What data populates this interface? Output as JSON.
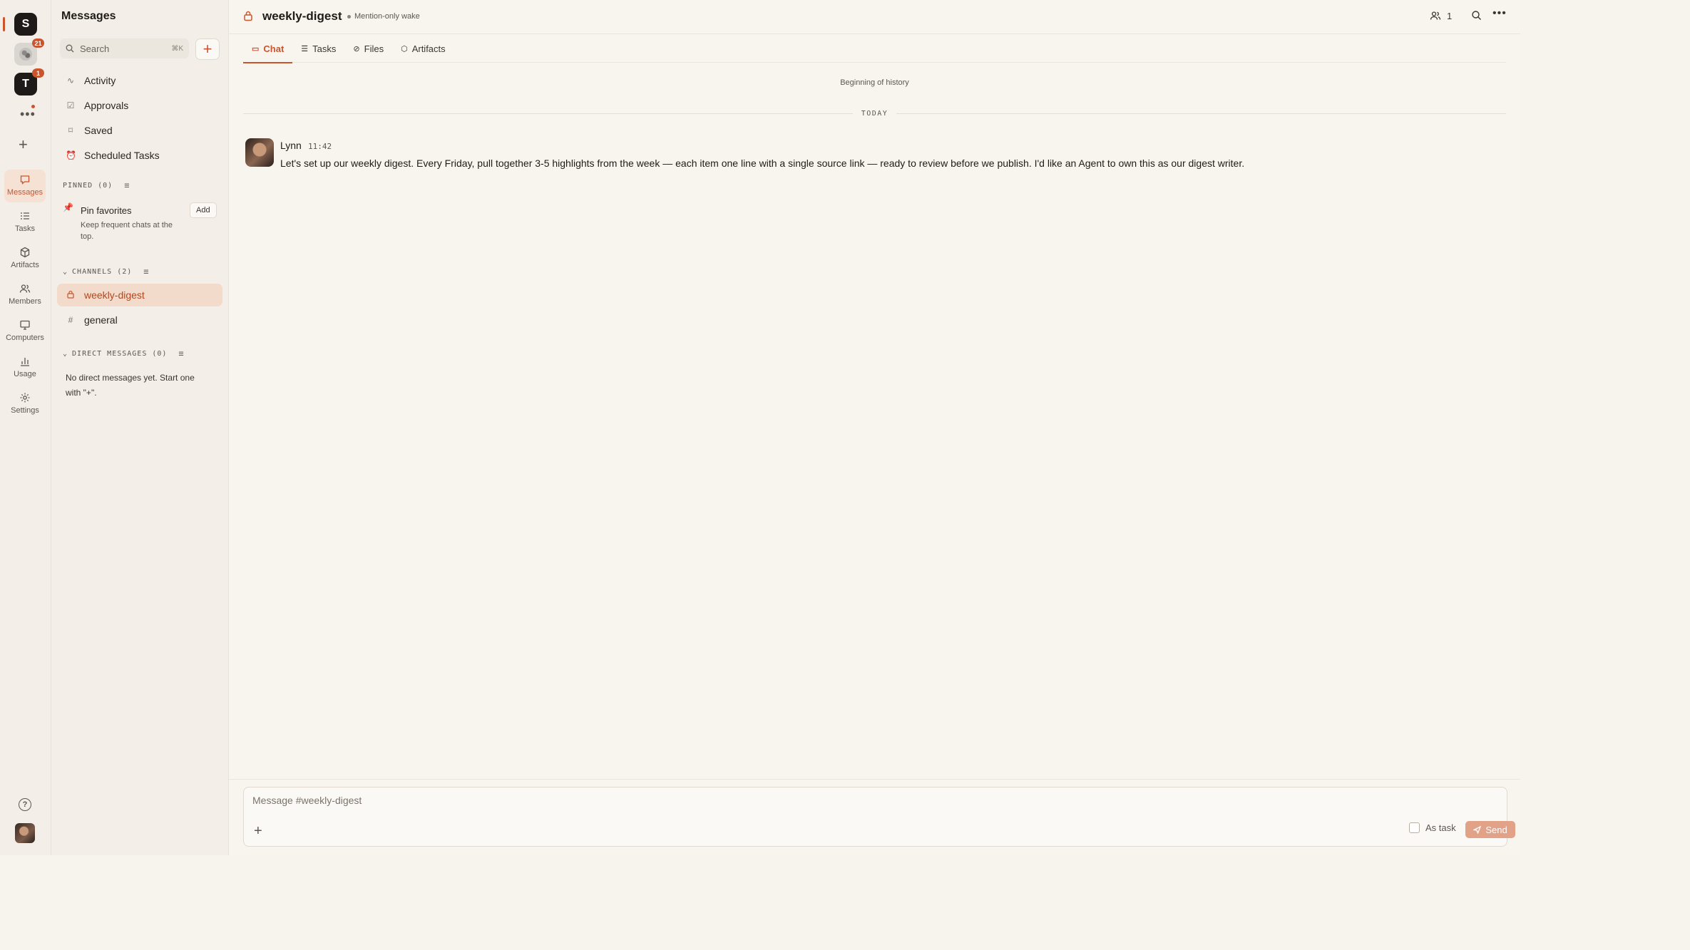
{
  "rail": {
    "workspaces": [
      {
        "letter": "S",
        "badge": ""
      },
      {
        "letter": "",
        "badge": "21"
      },
      {
        "letter": "T",
        "badge": "1"
      }
    ],
    "more": "•••",
    "add": "+",
    "nav": [
      {
        "label": "Messages",
        "icon": "message-icon",
        "active": true
      },
      {
        "label": "Tasks",
        "icon": "tasks-icon"
      },
      {
        "label": "Artifacts",
        "icon": "cube-icon"
      },
      {
        "label": "Members",
        "icon": "members-icon"
      },
      {
        "label": "Computers",
        "icon": "monitor-icon"
      },
      {
        "label": "Usage",
        "icon": "bar-chart-icon"
      },
      {
        "label": "Settings",
        "icon": "gear-icon"
      }
    ],
    "help": "?"
  },
  "sidebar": {
    "title": "Messages",
    "search_placeholder": "Search",
    "search_kbd": "⌘K",
    "new_label": "+",
    "items": [
      {
        "label": "Activity",
        "icon": "activity-icon"
      },
      {
        "label": "Approvals",
        "icon": "clipboard-icon"
      },
      {
        "label": "Saved",
        "icon": "bookmark-icon"
      },
      {
        "label": "Scheduled Tasks",
        "icon": "alarm-icon"
      }
    ],
    "pinned_header": "PINNED (0)",
    "pin_title": "Pin favorites",
    "pin_desc": "Keep frequent chats at the top.",
    "pin_add": "Add",
    "channels_header": "CHANNELS (2)",
    "channels": [
      {
        "label": "weekly-digest",
        "prefix": "🔒",
        "active": true
      },
      {
        "label": "general",
        "prefix": "#"
      }
    ],
    "dm_header": "DIRECT MESSAGES (0)",
    "dm_empty": "No direct messages yet. Start one with \"+\"."
  },
  "header": {
    "title": "weekly-digest",
    "subtitle": "Mention-only wake",
    "member_count": "1",
    "more": "•••"
  },
  "tabs": [
    {
      "label": "Chat",
      "icon": "chat-icon",
      "active": true
    },
    {
      "label": "Tasks",
      "icon": "tasks-icon"
    },
    {
      "label": "Files",
      "icon": "paperclip-icon"
    },
    {
      "label": "Artifacts",
      "icon": "cube-icon"
    }
  ],
  "chat": {
    "history_label": "Beginning of history",
    "day_divider": "TODAY",
    "messages": [
      {
        "author": "Lynn",
        "time": "11:42",
        "body": "Let's set up our weekly digest. Every Friday, pull together 3-5 highlights from the week — each item one line with a single source link — ready to review before we publish. I'd like an Agent to own this as our digest writer."
      }
    ]
  },
  "composer": {
    "placeholder": "Message #weekly-digest",
    "attach": "+",
    "as_task_label": "As task",
    "send_label": "Send"
  },
  "colors": {
    "accent": "#c8552e",
    "background": "#f7f4ee",
    "active_bg": "#f2dbcb"
  }
}
